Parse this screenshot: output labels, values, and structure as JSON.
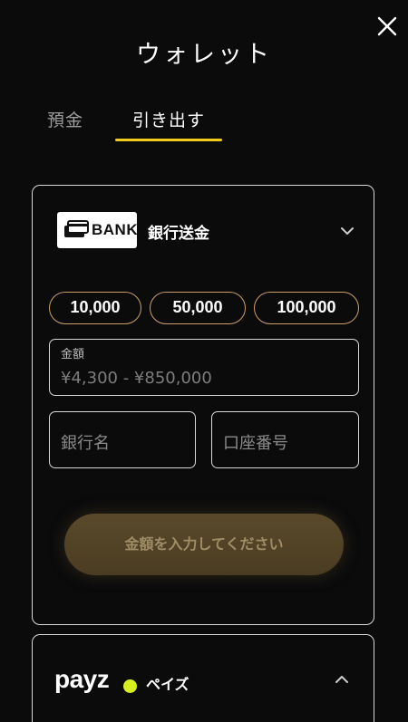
{
  "header": {
    "title": "ウォレット",
    "close_icon": "close-icon"
  },
  "tabs": [
    {
      "label": "預金",
      "active": false
    },
    {
      "label": "引き出す",
      "active": true
    }
  ],
  "accent_color": "#f2cc1d",
  "methods": {
    "bank": {
      "logo_text": "BANK",
      "name": "銀行送金",
      "expanded": true,
      "amount_chips": [
        "10,000",
        "50,000",
        "100,000"
      ],
      "amount_field": {
        "label": "金額",
        "placeholder": "¥4,300 - ¥850,000"
      },
      "bank_name_field": {
        "placeholder": "銀行名"
      },
      "account_number_field": {
        "placeholder": "口座番号"
      },
      "submit_label": "金額を入力してください"
    },
    "payz": {
      "logo_text": "payz",
      "name": "ペイズ",
      "expanded": false,
      "dot_color": "#d6f01f"
    }
  }
}
